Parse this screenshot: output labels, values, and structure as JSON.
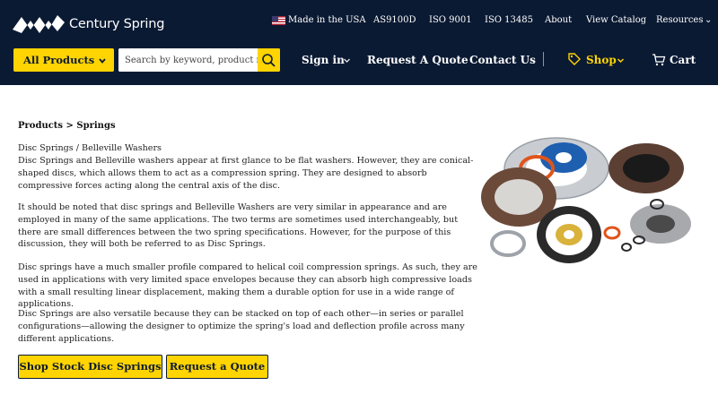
{
  "header": {
    "brand": "Century Spring",
    "top_nav": {
      "made_in_usa": "Made in the USA",
      "as9100d": "AS9100D",
      "iso9001": "ISO 9001",
      "iso13485": "ISO 13485",
      "about": "About",
      "view_catalog": "View Catalog",
      "resources": "Resources"
    },
    "all_products": "All Products",
    "search_placeholder": "Search by keyword, product number",
    "main_nav": {
      "sign_in": "Sign in",
      "request_quote": "Request A Quote",
      "contact_us": "Contact Us",
      "shop": "Shop",
      "cart": "Cart"
    }
  },
  "colors": {
    "navy": "#0b1a33",
    "yellow": "#ffd400"
  },
  "icons": [
    "logo-icon",
    "us-flag-icon",
    "chevron-down-icon",
    "search-icon",
    "tag-icon",
    "cart-icon"
  ],
  "main": {
    "breadcrumb": "Products > Springs",
    "title_line": "Disc Springs / Belleville Washers",
    "para1": "Disc Springs and Belleville washers appear at first glance to be flat washers. However, they are conical-shaped discs, which allows them to act as a compression spring. They are designed to absorb compressive forces acting along the central axis of the disc.",
    "para2": "It should be noted that disc springs and Belleville Washers are very similar in appearance and are employed in many of the same applications. The two terms are sometimes used interchangeably, but there are small differences between the two spring specifications. However, for the purpose of this discussion, they will both be referred to as Disc Springs.",
    "para3": "Disc springs have a much smaller profile compared to helical coil compression springs. As such, they are used in applications with very limited space envelopes because they can absorb high compressive loads with a small resulting linear displacement, making them a durable option for use in a wide range of applications.",
    "para4": "Disc Springs are also versatile because they can be stacked on top of each other—in series or parallel configurations—allowing the designer to optimize the spring's load and deflection profile across many different applications.",
    "btn_shop": "Shop Stock Disc Springs",
    "btn_quote": "Request a Quote"
  }
}
